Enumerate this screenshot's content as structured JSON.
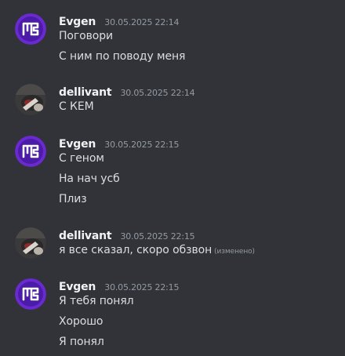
{
  "messages": [
    {
      "author": "Evgen",
      "avatar": "evgen-logo-icon",
      "time": "30.05.2025 22:14",
      "lines": [
        "Поговори",
        "С ним по поводу меня"
      ]
    },
    {
      "author": "dellivant",
      "avatar": "dellivant-photo-avatar",
      "time": "30.05.2025 22:14",
      "lines": [
        "С КЕМ"
      ]
    },
    {
      "author": "Evgen",
      "avatar": "evgen-logo-icon",
      "time": "30.05.2025 22:15",
      "lines": [
        "С геном",
        "На нач усб",
        "Плиз"
      ]
    },
    {
      "author": "dellivant",
      "avatar": "dellivant-photo-avatar",
      "time": "30.05.2025 22:15",
      "lines": [
        "я все сказал, скоро обзвон"
      ],
      "edited_label": "(изменено)"
    },
    {
      "author": "Evgen",
      "avatar": "evgen-logo-icon",
      "time": "30.05.2025 22:15",
      "lines": [
        "Я тебя понял",
        "Хорошо",
        "Я понял"
      ]
    }
  ],
  "colors": {
    "background": "#313338",
    "username": "#f2f3f5",
    "timestamp": "#949ba4",
    "message_text": "#dbdee1",
    "evgen_avatar_bg": "#6a2ad0"
  }
}
